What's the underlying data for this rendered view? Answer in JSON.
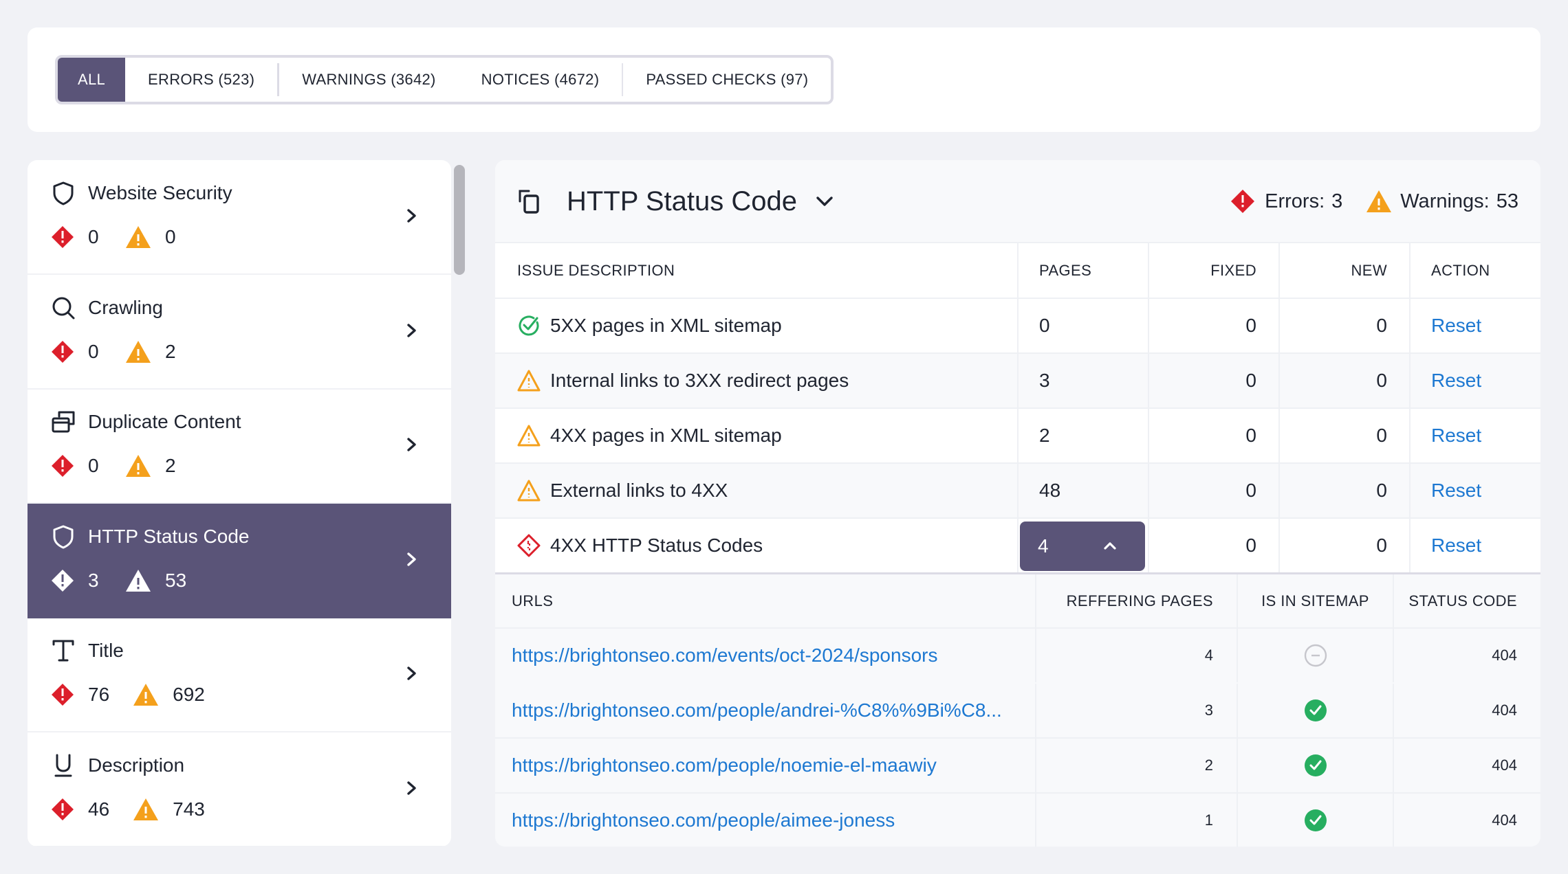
{
  "filter_tabs": [
    {
      "label": "ALL",
      "active": true
    },
    {
      "label": "ERRORS (523)",
      "active": false
    },
    {
      "label": "WARNINGS (3642)",
      "active": false
    },
    {
      "label": "NOTICES (4672)",
      "active": false
    },
    {
      "label": "PASSED CHECKS (97)",
      "active": false
    }
  ],
  "sidebar": {
    "items": [
      {
        "label": "Website Security",
        "icon": "shield-icon",
        "errors": "0",
        "warnings": "0",
        "active": false
      },
      {
        "label": "Crawling",
        "icon": "search-icon",
        "errors": "0",
        "warnings": "2",
        "active": false
      },
      {
        "label": "Duplicate Content",
        "icon": "duplicate-icon",
        "errors": "0",
        "warnings": "2",
        "active": false
      },
      {
        "label": "HTTP Status Code",
        "icon": "shield-icon",
        "errors": "3",
        "warnings": "53",
        "active": true
      },
      {
        "label": "Title",
        "icon": "text-icon",
        "errors": "76",
        "warnings": "692",
        "active": false
      },
      {
        "label": "Description",
        "icon": "underline-icon",
        "errors": "46",
        "warnings": "743",
        "active": false
      }
    ]
  },
  "main": {
    "title": "HTTP Status Code",
    "errors_label": "Errors:",
    "errors_value": "3",
    "warnings_label": "Warnings:",
    "warnings_value": "53",
    "columns": {
      "description": "ISSUE DESCRIPTION",
      "pages": "PAGES",
      "fixed": "FIXED",
      "new": "NEW",
      "action": "ACTION"
    },
    "issues": [
      {
        "status": "passed",
        "description": "5XX pages in XML sitemap",
        "pages": "0",
        "fixed": "0",
        "new": "0",
        "action": "Reset"
      },
      {
        "status": "warning",
        "description": "Internal links to 3XX redirect pages",
        "pages": "3",
        "fixed": "0",
        "new": "0",
        "action": "Reset"
      },
      {
        "status": "warning",
        "description": "4XX pages in XML sitemap",
        "pages": "2",
        "fixed": "0",
        "new": "0",
        "action": "Reset"
      },
      {
        "status": "warning",
        "description": "External links to 4XX",
        "pages": "48",
        "fixed": "0",
        "new": "0",
        "action": "Reset"
      },
      {
        "status": "error",
        "description": "4XX HTTP Status Codes",
        "pages": "4",
        "fixed": "0",
        "new": "0",
        "action": "Reset",
        "expanded": true
      }
    ],
    "details": {
      "columns": {
        "url": "URLS",
        "referring": "REFFERING PAGES",
        "sitemap": "IS IN SITEMAP",
        "status": "STATUS CODE"
      },
      "rows": [
        {
          "url": "https://brightonseo.com/events/oct-2024/sponsors",
          "referring": "4",
          "in_sitemap": false,
          "status_code": "404"
        },
        {
          "url": "https://brightonseo.com/people/andrei-%C8%%9Bi%C8...",
          "referring": "3",
          "in_sitemap": true,
          "status_code": "404"
        },
        {
          "url": "https://brightonseo.com/people/noemie-el-maawiy",
          "referring": "2",
          "in_sitemap": true,
          "status_code": "404"
        },
        {
          "url": "https://brightonseo.com/people/aimee-joness",
          "referring": "1",
          "in_sitemap": true,
          "status_code": "404"
        }
      ]
    }
  },
  "colors": {
    "accent": "#5a5478",
    "error": "#dc1f2b",
    "warning": "#f4a01c",
    "success": "#27ae60",
    "link": "#1d78d1"
  }
}
